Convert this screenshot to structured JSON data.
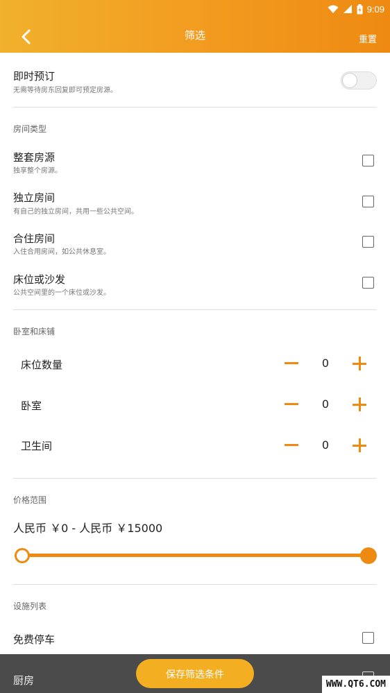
{
  "status_bar": {
    "time": "9:09"
  },
  "header": {
    "title": "筛选",
    "reset_label": "重置"
  },
  "instant_booking": {
    "label": "即时预订",
    "description": "无需等待房东回复即可预定房源。",
    "enabled": false
  },
  "room_type": {
    "section_title": "房间类型",
    "items": [
      {
        "label": "整套房源",
        "description": "独享整个房源。",
        "checked": false
      },
      {
        "label": "独立房间",
        "description": "有自己的独立房间，共用一些公共空间。",
        "checked": false
      },
      {
        "label": "合住房间",
        "description": "入住合用房间，如公共休息室。",
        "checked": false
      },
      {
        "label": "床位或沙发",
        "description": "公共空间里的一个床位或沙发。",
        "checked": false
      }
    ]
  },
  "bedrooms_beds": {
    "section_title": "卧室和床铺",
    "steppers": [
      {
        "label": "床位数量",
        "value": "0"
      },
      {
        "label": "卧室",
        "value": "0"
      },
      {
        "label": "卫生间",
        "value": "0"
      }
    ]
  },
  "price_range": {
    "section_title": "价格范围",
    "text": "人民币 ￥0 - 人民币 ￥15000",
    "min": 0,
    "max": 15000
  },
  "amenities": {
    "section_title": "设施列表",
    "items": [
      {
        "label": "免费停车",
        "checked": false
      },
      {
        "label": "厨房",
        "checked": false
      }
    ]
  },
  "footer": {
    "save_label": "保存筛选条件"
  },
  "watermark": "WWW.QT6.COM",
  "colors": {
    "accent": "#ee8a12",
    "header_start": "#f1b12c",
    "button": "#f3ae22"
  }
}
